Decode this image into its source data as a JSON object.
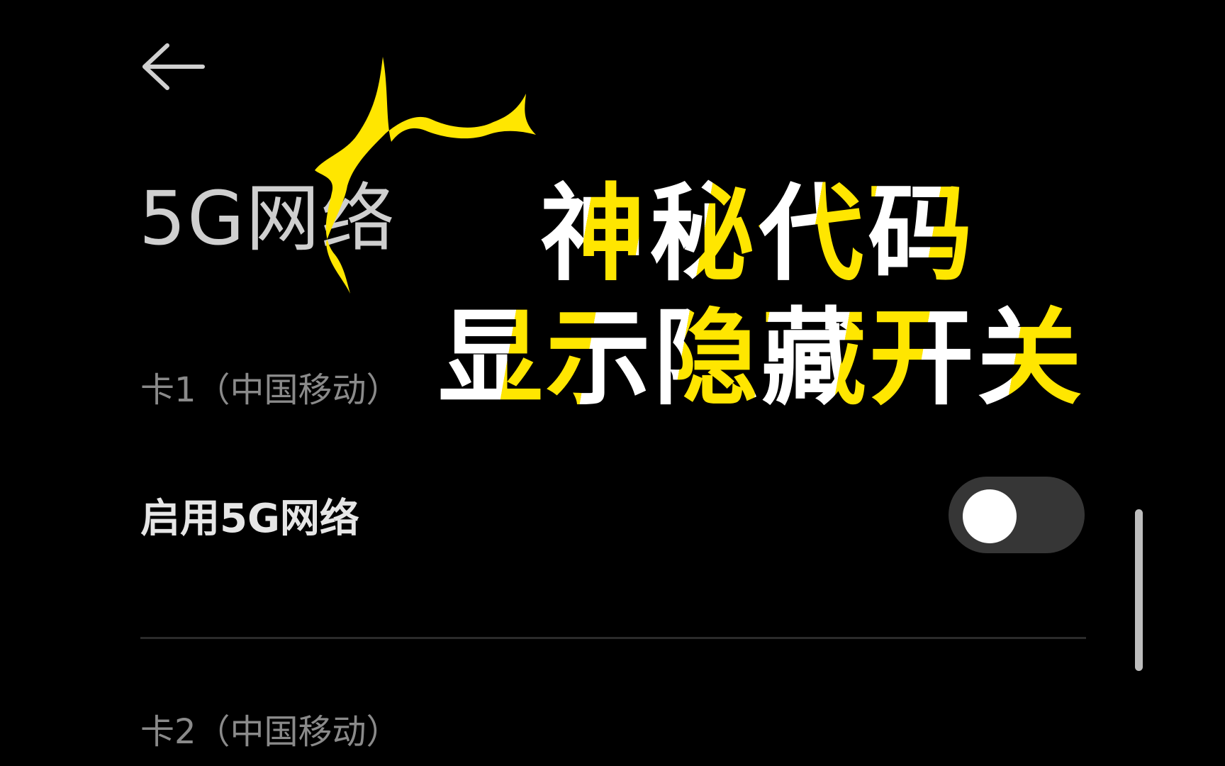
{
  "header": {
    "back_icon": "arrow-left-icon",
    "title": "5G网络"
  },
  "sections": [
    {
      "title": "卡1（中国移动）",
      "rows": [
        {
          "label": "启用5G网络",
          "toggle": {
            "on": false
          }
        }
      ]
    },
    {
      "title": "卡2（中国移动）",
      "rows": []
    }
  ],
  "overlay": {
    "line1": "神秘代码",
    "line2": "显示隐藏开关"
  },
  "colors": {
    "background": "#000000",
    "accent_yellow": "#ffe600",
    "toggle_track": "#363636",
    "toggle_knob": "#ffffff",
    "section_text": "#8a8a8a"
  }
}
